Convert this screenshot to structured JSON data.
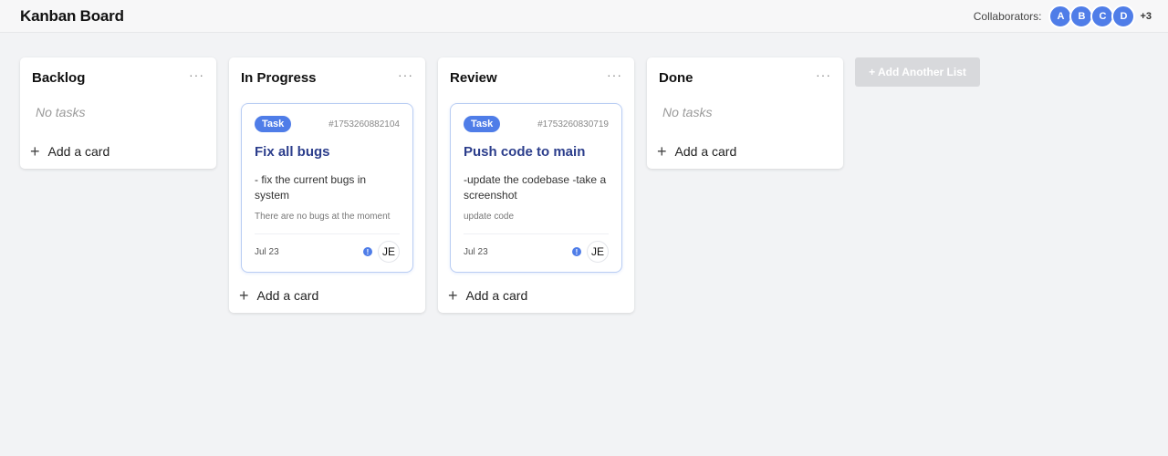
{
  "header": {
    "title": "Kanban Board",
    "collaborators_label": "Collaborators:",
    "avatars": [
      "A",
      "B",
      "C",
      "D"
    ],
    "more_count": "+3",
    "accent_color": "#4f7de8"
  },
  "lists": [
    {
      "title": "Backlog",
      "menu": "···",
      "empty_text": "No tasks",
      "add_card_label": "Add a card"
    },
    {
      "title": "In Progress",
      "menu": "···",
      "cards": [
        {
          "tag": "Task",
          "id": "#1753260882104",
          "title": "Fix all bugs",
          "description": "- fix the current bugs in system",
          "note": "There are no bugs at the moment",
          "date": "Jul 23",
          "assignee": "JE"
        }
      ],
      "add_card_label": "Add a card"
    },
    {
      "title": "Review",
      "menu": "···",
      "cards": [
        {
          "tag": "Task",
          "id": "#1753260830719",
          "title": "Push code to main",
          "description": "-update the codebase -take a screenshot",
          "note": "update code",
          "date": "Jul 23",
          "assignee": "JE"
        }
      ],
      "add_card_label": "Add a card"
    },
    {
      "title": "Done",
      "menu": "···",
      "empty_text": "No tasks",
      "add_card_label": "Add a card"
    }
  ],
  "add_list_label": "+ Add Another List"
}
